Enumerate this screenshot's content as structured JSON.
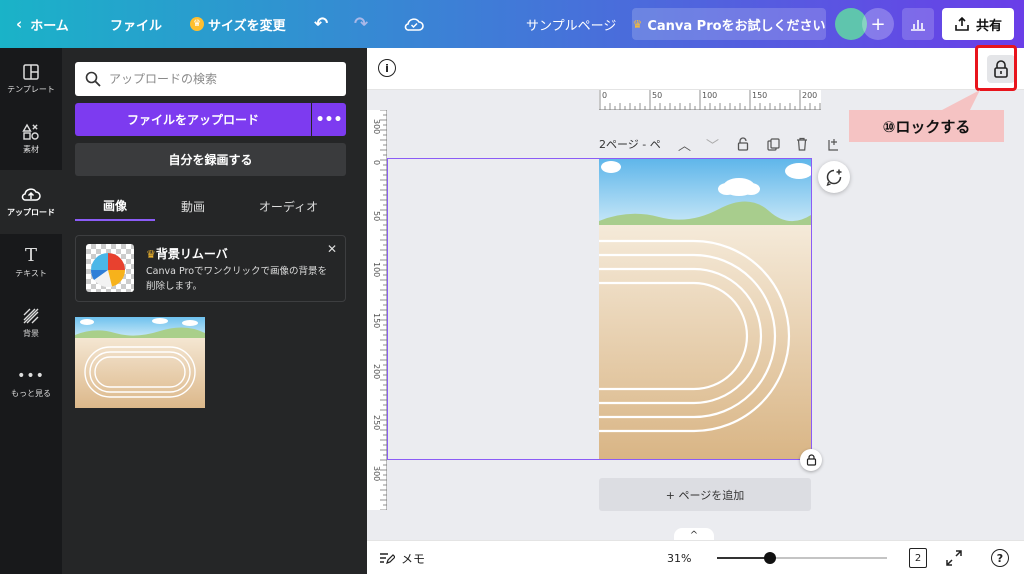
{
  "topbar": {
    "home": "ホーム",
    "file": "ファイル",
    "resize": "サイズを変更",
    "title": "サンプルページ",
    "pro": "Canva Proをお試しください",
    "share": "共有"
  },
  "rail": [
    {
      "label": "テンプレート",
      "icon": "template-icon"
    },
    {
      "label": "素材",
      "icon": "elements-icon"
    },
    {
      "label": "アップロード",
      "icon": "upload-icon"
    },
    {
      "label": "テキスト",
      "icon": "text-icon"
    },
    {
      "label": "背景",
      "icon": "background-icon"
    },
    {
      "label": "もっと見る",
      "icon": "more-icon"
    }
  ],
  "panel": {
    "search_placeholder": "アップロードの検索",
    "upload_button": "ファイルをアップロード",
    "record_button": "自分を録画する",
    "tabs": [
      "画像",
      "動画",
      "オーディオ"
    ],
    "promo_title": "背景リムーバ",
    "promo_text": "Canva Proでワンクリックで画像の背景を削除します。"
  },
  "editor": {
    "page_label": "2ページ - ペ",
    "add_page": "+ ページを追加",
    "ruler_top": [
      "0",
      "50",
      "100",
      "150",
      "200"
    ],
    "ruler_left": [
      "300",
      "0",
      "50",
      "100",
      "150",
      "200",
      "250",
      "300"
    ]
  },
  "bottom": {
    "notes": "メモ",
    "zoom": "31%",
    "zoom_fraction": 0.31,
    "page_count": "2"
  },
  "annotation": {
    "callout": "⑩ロックする"
  },
  "colors": {
    "accent": "#7d3bf0",
    "selection": "#8b5cf6",
    "highlight": "#e8141c"
  }
}
